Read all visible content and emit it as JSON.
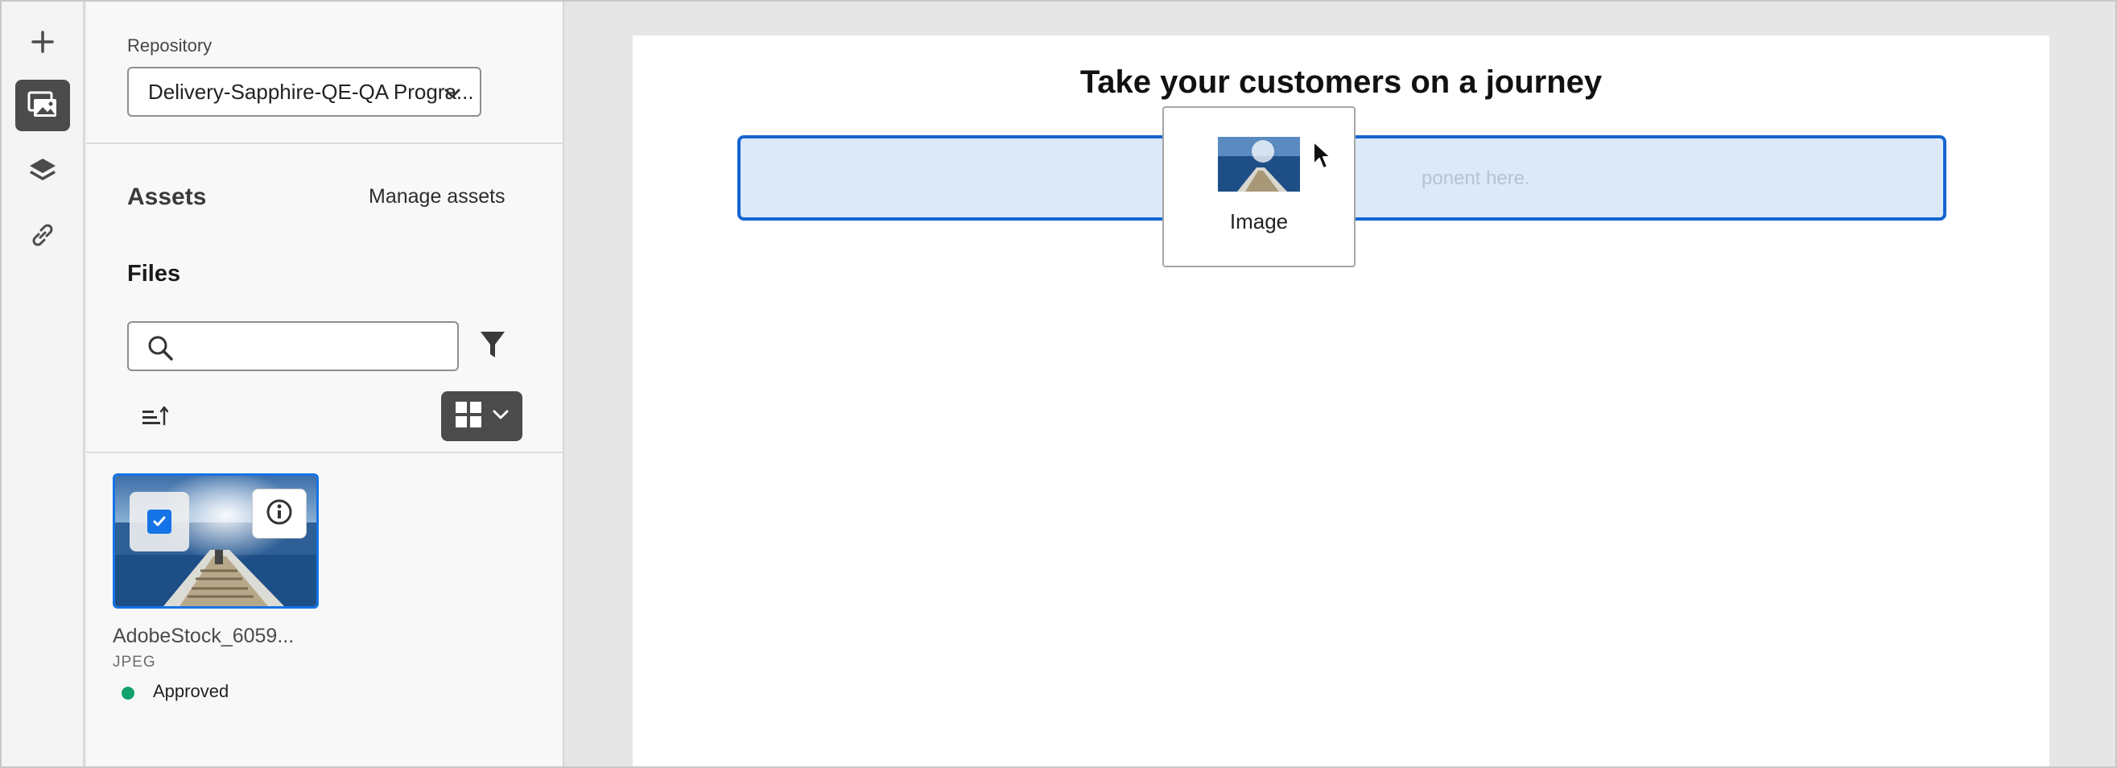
{
  "rail": {
    "items": [
      {
        "name": "add",
        "icon": "plus-icon"
      },
      {
        "name": "assets",
        "icon": "assets-icon",
        "active": true
      },
      {
        "name": "layers",
        "icon": "layers-icon"
      },
      {
        "name": "links",
        "icon": "link-icon"
      }
    ]
  },
  "panel": {
    "repository_label": "Repository",
    "repository_value": "Delivery-Sapphire-QE-QA Progra...",
    "assets_title": "Assets",
    "manage_assets": "Manage assets",
    "files_title": "Files",
    "search_placeholder": "",
    "asset": {
      "name": "AdobeStock_6059...",
      "type": "JPEG",
      "status": "Approved",
      "status_color": "#12a16b",
      "selected": true
    }
  },
  "canvas": {
    "title": "Take your customers on a journey",
    "dropzone_text": "ponent here.",
    "drag_label": "Image"
  },
  "colors": {
    "accent": "#1473e6",
    "dropzone_bg": "#dce9f9",
    "rail_active": "#4b4b4b"
  }
}
